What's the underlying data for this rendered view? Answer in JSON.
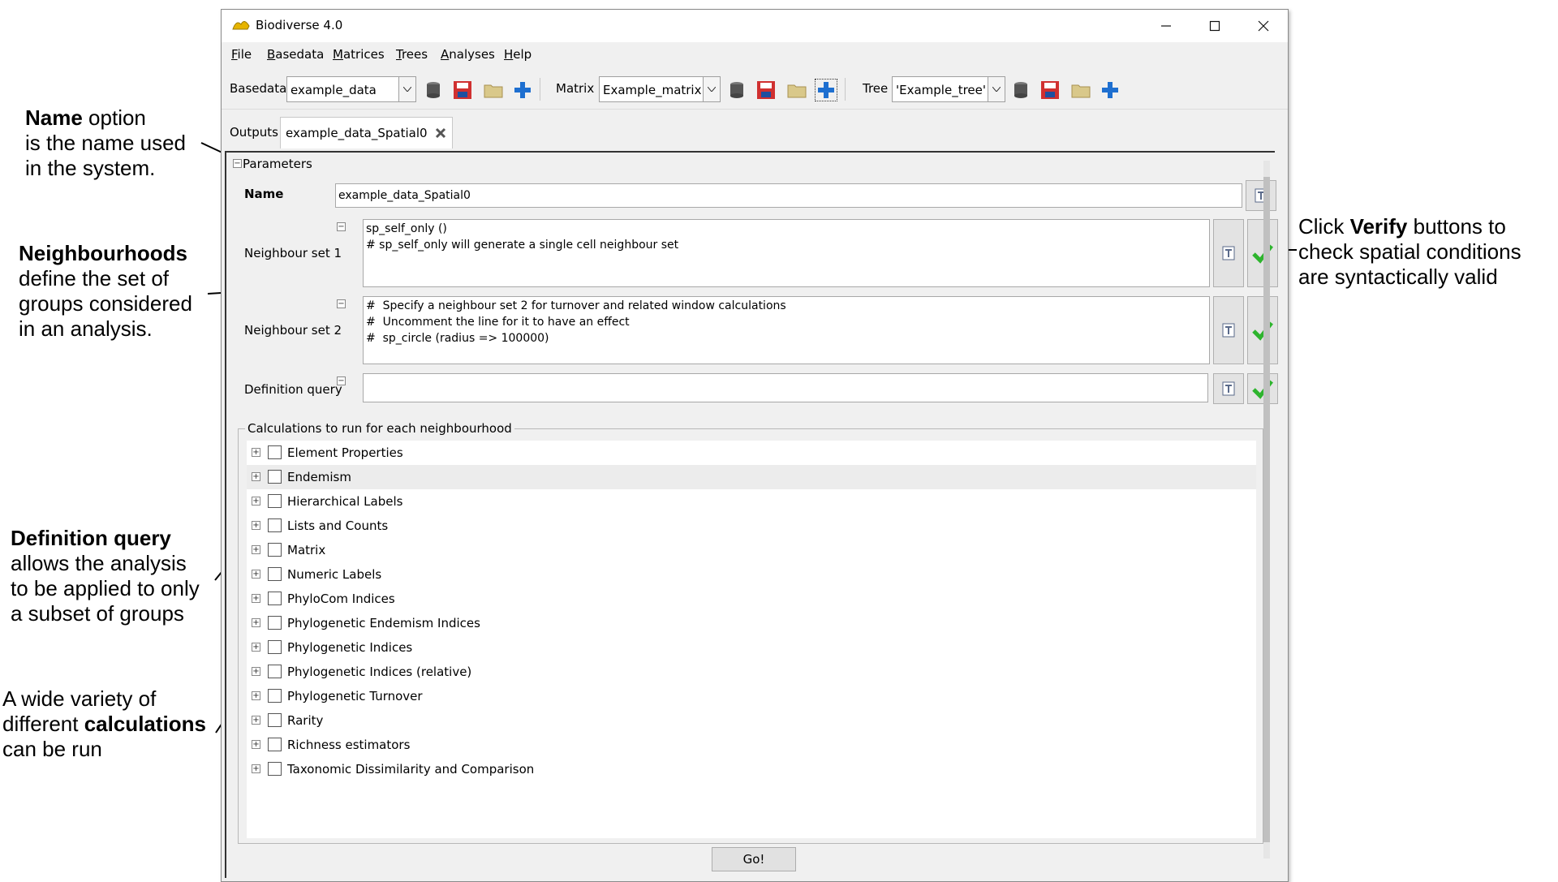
{
  "annotations": {
    "name": {
      "bold": "Name",
      "rest": " option",
      "lines": [
        "is the name used",
        "in the system."
      ]
    },
    "neighbourhoods": {
      "bold": "Neighbourhoods",
      "lines": [
        "define the set of",
        "groups considered",
        "in an analysis."
      ]
    },
    "definition": {
      "bold": "Definition query",
      "lines": [
        "allows the analysis",
        "to be applied to only",
        "a subset of groups"
      ]
    },
    "calculations": {
      "line1": "A wide variety of",
      "pre": "different ",
      "bold": "calculations",
      "line3": "can be run"
    },
    "verify": {
      "pre": "Click ",
      "bold": "Verify",
      "post": " buttons to",
      "lines": [
        "check spatial conditions",
        "are syntactically valid"
      ]
    }
  },
  "window": {
    "title": "Biodiverse 4.0"
  },
  "menu": [
    "File",
    "Basedata",
    "Matrices",
    "Trees",
    "Analyses",
    "Help"
  ],
  "toolbar": {
    "basedata_label": "Basedata",
    "basedata_value": "example_data",
    "matrix_label": "Matrix",
    "matrix_value": "Example_matrix",
    "tree_label": "Tree",
    "tree_value": "'Example_tree'"
  },
  "tabs": {
    "outputs": "Outputs",
    "active": "example_data_Spatial0"
  },
  "parameters": {
    "section_label": "Parameters",
    "name_label": "Name",
    "name_value": "example_data_Spatial0",
    "nbr1_label": "Neighbour set 1",
    "nbr1_lines": [
      "sp_self_only ()",
      "# sp_self_only will generate a single cell neighbour set"
    ],
    "nbr2_label": "Neighbour set 2",
    "nbr2_lines": [
      "#  Specify a neighbour set 2 for turnover and related window calculations",
      "#  Uncomment the line for it to have an effect",
      "#  sp_circle (radius => 100000)"
    ],
    "defq_label": "Definition query",
    "defq_value": ""
  },
  "calculations": {
    "legend": "Calculations to run for each neighbourhood",
    "items": [
      "Element Properties",
      "Endemism",
      "Hierarchical Labels",
      "Lists and Counts",
      "Matrix",
      "Numeric Labels",
      "PhyloCom Indices",
      "Phylogenetic Endemism Indices",
      "Phylogenetic Indices",
      "Phylogenetic Indices (relative)",
      "Phylogenetic Turnover",
      "Rarity",
      "Richness estimators",
      "Taxonomic Dissimilarity and Comparison"
    ]
  },
  "go_button": "Go!",
  "colors": {
    "verify_green": "#2db42d",
    "save_red": "#d03030",
    "plus_blue": "#1e6fd0",
    "folder_tan": "#d9c88a"
  }
}
